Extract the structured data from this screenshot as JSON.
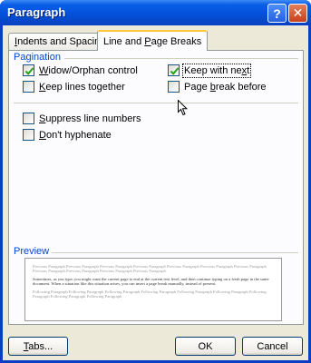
{
  "window": {
    "title": "Paragraph",
    "help_glyph": "?",
    "close_glyph": "✕"
  },
  "tabs": [
    {
      "label_prefix": "",
      "mnemonic": "I",
      "label_rest": "ndents and Spacing"
    },
    {
      "label_prefix": "Line and ",
      "mnemonic": "P",
      "label_rest": "age Breaks"
    }
  ],
  "pagination": {
    "label": "Pagination",
    "options": [
      {
        "pre": "",
        "mn": "W",
        "post": "idow/Orphan control",
        "checked": true
      },
      {
        "pre": "",
        "mn": "K",
        "post": "eep lines together",
        "checked": false
      },
      {
        "pre": "Keep with ne",
        "mn": "x",
        "post": "t",
        "checked": true
      },
      {
        "pre": "Page ",
        "mn": "b",
        "post": "reak before",
        "checked": false
      }
    ]
  },
  "other": [
    {
      "pre": "",
      "mn": "S",
      "post": "uppress line numbers",
      "checked": false
    },
    {
      "pre": "",
      "mn": "D",
      "post": "on't hyphenate",
      "checked": false
    }
  ],
  "preview": {
    "label": "Preview",
    "prev_text": "Previous Paragraph Previous Paragraph Previous Paragraph Previous Paragraph Previous Paragraph Previous Paragraph Previous Paragraph Previous Paragraph Previous Paragraph Previous Paragraph Previous Paragraph",
    "sample_text": "Sometimes, as you type, you might want the current page to end at the current text level, and then continue typing on a fresh page in the same document. When a situation like this situation arises, you can insert a page break manually, instead of present.",
    "next_text": "Following Paragraph Following Paragraph Following Paragraph Following Paragraph Following Paragraph Following Paragraph Following Paragraph Following Paragraph Following Paragraph"
  },
  "buttons": {
    "tabs": {
      "mn": "T",
      "post": "abs..."
    },
    "ok": "OK",
    "cancel": "Cancel"
  }
}
